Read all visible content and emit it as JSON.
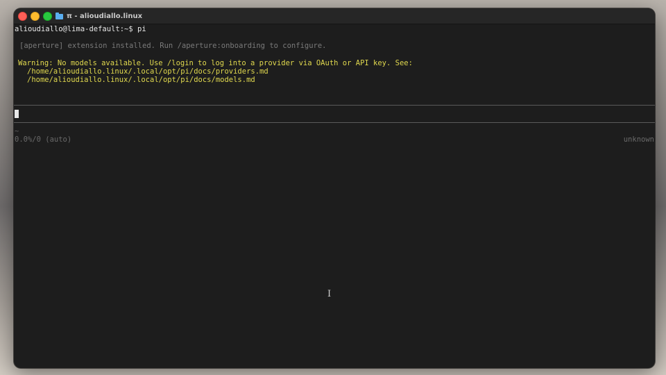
{
  "window": {
    "title": "π - alioudiallo.linux",
    "folder_icon": "folder-icon"
  },
  "terminal": {
    "prompt_line": "alioudiallo@lima-default:~$ pi",
    "info_line": "[aperture] extension installed. Run /aperture:onboarding to configure.",
    "warning_lines": [
      "Warning: No models available. Use /login to log into a provider via OAuth or API key. See:",
      "/home/alioudiallo.linux/.local/opt/pi/docs/providers.md",
      "/home/alioudiallo.linux/.local/opt/pi/docs/models.md"
    ],
    "input_value": "",
    "tilde": "~",
    "status_left": "0.0%/0 (auto)",
    "status_right": "unknown"
  },
  "colors": {
    "background": "#1d1d1d",
    "warning": "#e0d84e",
    "info": "#7a7a7a",
    "close": "#fe5f57",
    "minimize": "#febc2e",
    "maximize": "#28c840"
  }
}
